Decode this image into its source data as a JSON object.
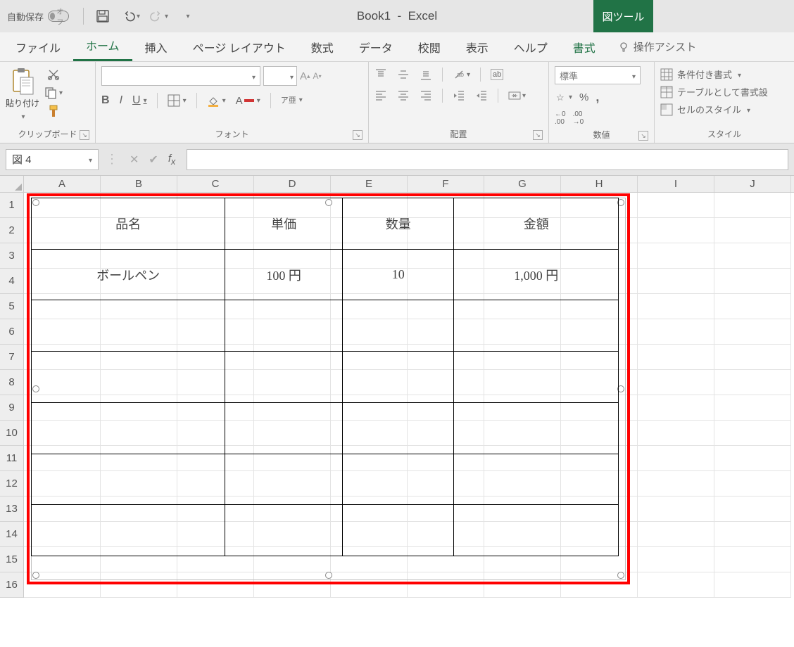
{
  "titlebar": {
    "autosave_label": "自動保存",
    "autosave_state": "オフ",
    "doc_title": "Book1",
    "app_name": "Excel",
    "tool_tab": "図ツール"
  },
  "tabs": {
    "file": "ファイル",
    "home": "ホーム",
    "insert": "挿入",
    "layout": "ページ レイアウト",
    "formulas": "数式",
    "data": "データ",
    "review": "校閲",
    "view": "表示",
    "help": "ヘルプ",
    "format": "書式",
    "tellme": "操作アシスト"
  },
  "ribbon": {
    "clipboard": {
      "paste": "貼り付け",
      "label": "クリップボード"
    },
    "font": {
      "label": "フォント",
      "bold": "B",
      "italic": "I",
      "underline": "U",
      "phonetic": "ア亜"
    },
    "alignment": {
      "label": "配置",
      "wrap": "ab"
    },
    "number": {
      "label": "数値",
      "format_name": "標準"
    },
    "styles": {
      "label": "スタイル",
      "conditional": "条件付き書式",
      "as_table": "テーブルとして書式設",
      "cell_styles": "セルのスタイル"
    }
  },
  "namebox": {
    "value": "図 4"
  },
  "columns": [
    "A",
    "B",
    "C",
    "D",
    "E",
    "F",
    "G",
    "H",
    "I",
    "J"
  ],
  "rows": [
    "1",
    "2",
    "3",
    "4",
    "5",
    "6",
    "7",
    "8",
    "9",
    "10",
    "11",
    "12",
    "13",
    "14",
    "15",
    "16"
  ],
  "table": {
    "headers": {
      "name": "品名",
      "price": "単価",
      "qty": "数量",
      "total": "金額"
    },
    "row1": {
      "name": "ボールペン",
      "price": "100 円",
      "qty": "10",
      "total": "1,000 円"
    }
  }
}
